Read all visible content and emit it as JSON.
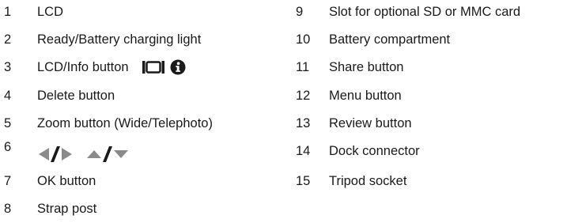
{
  "colors": {
    "text": "#1a1a1a",
    "icon": "#1a1a1a",
    "arrow": "#8a8a8a"
  },
  "left_column": [
    {
      "number": "1",
      "label": "LCD"
    },
    {
      "number": "2",
      "label": "Ready/Battery charging light"
    },
    {
      "number": "3",
      "label": "LCD/Info button",
      "icons": [
        "lcd-frame-icon",
        "info-icon"
      ]
    },
    {
      "number": "4",
      "label": "Delete button"
    },
    {
      "number": "5",
      "label": "Zoom button (Wide/Telephoto)"
    },
    {
      "number": "6",
      "label": "",
      "icons": [
        "arrow-left-icon",
        "slash-icon",
        "arrow-right-icon",
        "arrow-up-icon",
        "slash-icon",
        "arrow-down-icon"
      ]
    },
    {
      "number": "7",
      "label": "OK button"
    },
    {
      "number": "8",
      "label": "Strap post"
    }
  ],
  "right_column": [
    {
      "number": "9",
      "label": "Slot for optional SD or MMC card"
    },
    {
      "number": "10",
      "label": "Battery compartment"
    },
    {
      "number": "11",
      "label": "Share button"
    },
    {
      "number": "12",
      "label": "Menu button"
    },
    {
      "number": "13",
      "label": "Review button"
    },
    {
      "number": "14",
      "label": "Dock connector"
    },
    {
      "number": "15",
      "label": "Tripod socket"
    }
  ]
}
